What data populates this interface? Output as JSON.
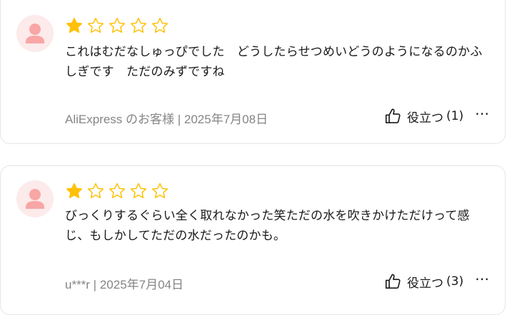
{
  "reviews": [
    {
      "rating": 1,
      "max_rating": 5,
      "text": "これはむだなしゅっぴでした　どうしたらせつめいどうのようになるのかふしぎです　ただのみずですね",
      "author_date": "AliExpress のお客様 | 2025年7月08日",
      "helpful_label": "役立つ",
      "helpful_count": "(1)",
      "more": "⋯"
    },
    {
      "rating": 1,
      "max_rating": 5,
      "text": "びっくりするぐらい全く取れなかった笑ただの水を吹きかけただけって感じ、もしかしてただの水だったのかも。",
      "author_date": "u***r | 2025年7月04日",
      "helpful_label": "役立つ",
      "helpful_count": "(3)",
      "more": "⋯"
    }
  ],
  "colors": {
    "star_filled": "#FFC107",
    "star_outline": "#FFC107",
    "avatar_bg": "#FDEAEA",
    "avatar_figure": "#F8A6A6",
    "meta_text": "#858585"
  }
}
